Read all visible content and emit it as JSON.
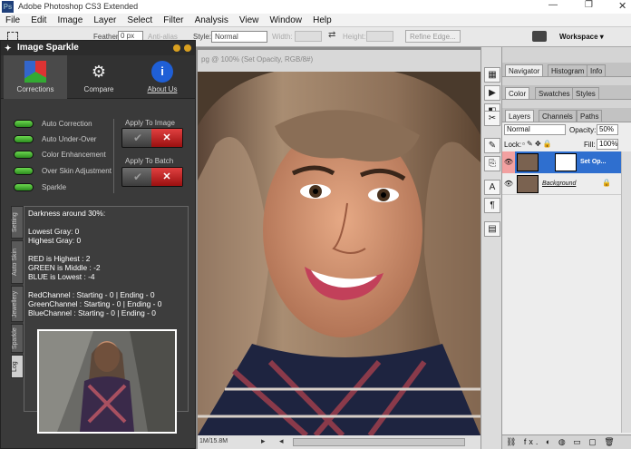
{
  "window": {
    "title": "Adobe Photoshop CS3 Extended",
    "app_icon": "Ps"
  },
  "menu": [
    "File",
    "Edit",
    "Image",
    "Layer",
    "Select",
    "Filter",
    "Analysis",
    "View",
    "Window",
    "Help"
  ],
  "options": {
    "feather_label": "Feather:",
    "feather_value": "0 px",
    "antialias": "Anti-alias",
    "style_label": "Style:",
    "style_value": "Normal",
    "width_label": "Width:",
    "height_label": "Height:",
    "refine": "Refine Edge...",
    "workspace": "Workspace ▾"
  },
  "document": {
    "tab": "pg @ 100% (Set Opacity, RGB/8#)",
    "status": "1M/15.8M"
  },
  "plugin": {
    "title": "Image Sparkle",
    "tabs": [
      {
        "label": "Corrections"
      },
      {
        "label": "Compare"
      },
      {
        "label": "About Us"
      }
    ],
    "options": [
      "Auto Correction",
      "Auto Under-Over",
      "Color Enhancement",
      "Over Skin Adjustment",
      "Sparkle"
    ],
    "apply_image": "Apply To Image",
    "apply_batch": "Apply To Batch",
    "side_tabs": [
      "Setting",
      "Auto Skin",
      "Jewellery",
      "Sparkle",
      "Log"
    ],
    "log": [
      "Darkness around 30%:",
      "",
      "Lowest Gray: 0",
      "Highest Gray: 0",
      "",
      "RED is Highest : 2",
      "GREEN is Middle : -2",
      "BLUE is Lowest : -4",
      "",
      "RedChannel : Starting - 0 | Ending - 0",
      "GreenChannel : Starting - 0 | Ending - 0",
      "BlueChannel : Starting - 0 | Ending - 0"
    ]
  },
  "panels": {
    "group1": [
      "Navigator",
      "Histogram",
      "Info"
    ],
    "group2": [
      "Color",
      "Swatches",
      "Styles"
    ],
    "group3": [
      "Layers",
      "Channels",
      "Paths"
    ],
    "blend": "Normal",
    "opacity_label": "Opacity:",
    "opacity": "50%",
    "lock_label": "Lock:",
    "fill_label": "Fill:",
    "fill": "100%",
    "layers": [
      {
        "name": "Set Op..."
      },
      {
        "name": "Background"
      }
    ],
    "bottom_icons": "⛓ fx. ◐ ◍ ▭ ▢ 🗑"
  }
}
